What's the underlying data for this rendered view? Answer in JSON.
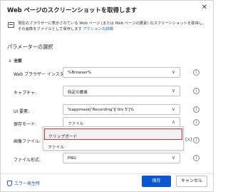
{
  "dialog": {
    "title": "Web ページのスクリーンショットを取得します",
    "close_glyph": "✕",
    "description_prefix": "現在のブラウザーに表示されている Web ページ (または Web ページの要素) のスクリーンショットを取得し、その画像をファ",
    "description_suffix": "イルとして保存します",
    "description_link": "アクションの詳細",
    "section_title": "パラメーターの選択",
    "group_label": "全般",
    "group_chevron": "∨"
  },
  "fields": {
    "browser_instance": {
      "label": "Web ブラウザー インスタンス:",
      "value": "%Browser%"
    },
    "capture": {
      "label": "キャプチャ:",
      "value": "特定の要素"
    },
    "ui_element": {
      "label": "UI 要素:",
      "value": "%appmask['Recording']['div 5']%"
    },
    "save_mode": {
      "label": "保存モード:",
      "value": "ファイル"
    },
    "image_file": {
      "label": "画像ファイル:",
      "value": ""
    },
    "file_format": {
      "label": "ファイル形式:",
      "value": "PNG"
    }
  },
  "dropdown": {
    "options": [
      "クリップボード",
      "ファイル"
    ],
    "highlighted_index": 0
  },
  "glyphs": {
    "caret": "∨",
    "fx": "{x}",
    "info": "i",
    "var_icon": "{x}"
  },
  "footer": {
    "error_link": "エラー発生時",
    "save_label": "保存",
    "cancel_label": "キャンセル"
  },
  "colors": {
    "accent": "#0b57d0",
    "link": "#1a5fb4",
    "highlight_border": "#d32f2f"
  }
}
